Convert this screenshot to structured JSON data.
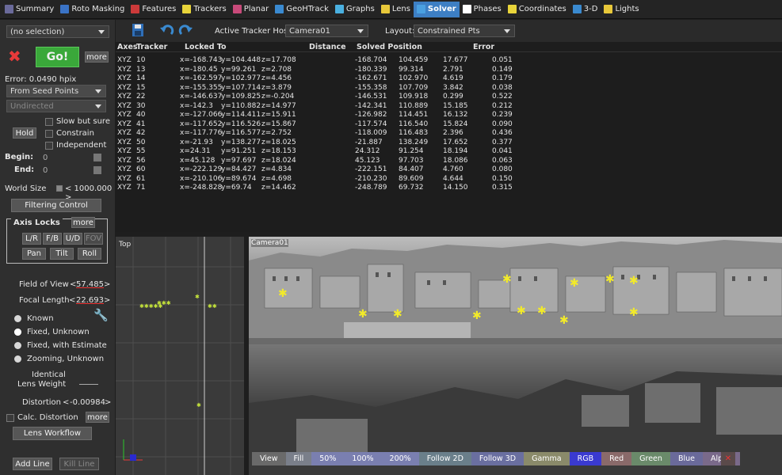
{
  "tabs": [
    {
      "label": "Summary",
      "icon": "summary-icon",
      "color": "#6a6a9a"
    },
    {
      "label": "Roto Masking",
      "icon": "roto-masking-icon",
      "color": "#3a73c6"
    },
    {
      "label": "Features",
      "icon": "features-icon",
      "color": "#cc3a3a"
    },
    {
      "label": "Trackers",
      "icon": "trackers-icon",
      "color": "#e8d43a"
    },
    {
      "label": "Planar",
      "icon": "planar-icon",
      "color": "#c84a7a"
    },
    {
      "label": "GeoHTrack",
      "icon": "geohtrack-icon",
      "color": "#3a8ad0"
    },
    {
      "label": "Graphs",
      "icon": "graphs-icon",
      "color": "#4ab0e0"
    },
    {
      "label": "Lens",
      "icon": "lens-icon",
      "color": "#e8c83a"
    },
    {
      "label": "Solver",
      "icon": "solver-icon",
      "color": "#4aa0e0",
      "active": true
    },
    {
      "label": "Phases",
      "icon": "phases-icon",
      "color": "#ffffff"
    },
    {
      "label": "Coordinates",
      "icon": "coordinates-icon",
      "color": "#e8d43a"
    },
    {
      "label": "3-D",
      "icon": "3d-icon",
      "color": "#3a8ad0"
    },
    {
      "label": "Lights",
      "icon": "lights-icon",
      "color": "#e8c83a"
    }
  ],
  "left": {
    "selection": "(no selection)",
    "go": "Go!",
    "more": "more",
    "error": "Error:  0.0490 hpix",
    "from_seed": "From Seed Points",
    "undirected": "Undirected",
    "slow": "Slow but sure",
    "hold": "Hold",
    "constrain": "Constrain",
    "independent": "Independent",
    "begin_label": "Begin:",
    "begin_val": "0",
    "end_label": "End:",
    "end_val": "0",
    "world_size_label": "World Size",
    "world_size_val": "< 1000.000 >",
    "filtering": "Filtering Control",
    "axis_locks": "Axis Locks",
    "axis_more": "more",
    "lr": "L/R",
    "fb": "F/B",
    "ud": "U/D",
    "fov": "FOV",
    "pan": "Pan",
    "tilt": "Tilt",
    "roll": "Roll",
    "fov_label": "Field of View",
    "fov_val": "57.485",
    "focal_label": "Focal Length",
    "focal_val": "22.693",
    "known": "Known",
    "fixed_unknown": "Fixed, Unknown",
    "fixed_estimate": "Fixed, with Estimate",
    "zooming": "Zooming, Unknown",
    "identical": "Identical",
    "lens_weight": "Lens Weight",
    "distortion_label": "Distortion",
    "distortion_val": "-0.00984",
    "calc_distortion": "Calc. Distortion",
    "calc_more": "more",
    "lens_workflow": "Lens Workflow",
    "add_line": "Add Line",
    "kill_line": "Kill Line",
    "lt": "<",
    "gt": ">"
  },
  "toolbar": {
    "host_label": "Active Tracker Host:",
    "host_value": "Camera01",
    "layout_label": "Layout:",
    "layout_value": "Constrained Pts"
  },
  "table": {
    "headers": {
      "axes": "Axes",
      "tracker": "Tracker",
      "locked": "Locked To",
      "distance": "Distance",
      "solved": "Solved Position",
      "error": "Error"
    },
    "rows": [
      {
        "axes": "XYZ",
        "tracker": "10",
        "lx": "x=-168.743",
        "ly": "y=104.448",
        "lz": "z=17.708",
        "sx": "-168.704",
        "sy": "104.459",
        "sz": "17.677",
        "err": "0.051"
      },
      {
        "axes": "XYZ",
        "tracker": "13",
        "lx": "x=-180.45",
        "ly": "y=99.261",
        "lz": "z=2.708",
        "sx": "-180.339",
        "sy": "99.314",
        "sz": "2.791",
        "err": "0.149"
      },
      {
        "axes": "XYZ",
        "tracker": "14",
        "lx": "x=-162.597",
        "ly": "y=102.977",
        "lz": "z=4.456",
        "sx": "-162.671",
        "sy": "102.970",
        "sz": "4.619",
        "err": "0.179"
      },
      {
        "axes": "XYZ",
        "tracker": "15",
        "lx": "x=-155.355",
        "ly": "y=107.714",
        "lz": "z=3.879",
        "sx": "-155.358",
        "sy": "107.709",
        "sz": "3.842",
        "err": "0.038"
      },
      {
        "axes": "XYZ",
        "tracker": "22",
        "lx": "x=-146.637",
        "ly": "y=109.825",
        "lz": "z=-0.204",
        "sx": "-146.531",
        "sy": "109.918",
        "sz": "0.299",
        "err": "0.522"
      },
      {
        "axes": "XYZ",
        "tracker": "30",
        "lx": "x=-142.3",
        "ly": "y=110.882",
        "lz": "z=14.977",
        "sx": "-142.341",
        "sy": "110.889",
        "sz": "15.185",
        "err": "0.212"
      },
      {
        "axes": "XYZ",
        "tracker": "40",
        "lx": "x=-127.066",
        "ly": "y=114.411",
        "lz": "z=15.911",
        "sx": "-126.982",
        "sy": "114.451",
        "sz": "16.132",
        "err": "0.239"
      },
      {
        "axes": "XYZ",
        "tracker": "41",
        "lx": "x=-117.652",
        "ly": "y=116.526",
        "lz": "z=15.867",
        "sx": "-117.574",
        "sy": "116.540",
        "sz": "15.824",
        "err": "0.090"
      },
      {
        "axes": "XYZ",
        "tracker": "42",
        "lx": "x=-117.776",
        "ly": "y=116.577",
        "lz": "z=2.752",
        "sx": "-118.009",
        "sy": "116.483",
        "sz": "2.396",
        "err": "0.436"
      },
      {
        "axes": "XYZ",
        "tracker": "50",
        "lx": "x=-21.93",
        "ly": "y=138.277",
        "lz": "z=18.025",
        "sx": "-21.887",
        "sy": "138.249",
        "sz": "17.652",
        "err": "0.377"
      },
      {
        "axes": "XYZ",
        "tracker": "55",
        "lx": "x=24.31",
        "ly": "y=91.251",
        "lz": "z=18.153",
        "sx": "24.312",
        "sy": "91.254",
        "sz": "18.194",
        "err": "0.041"
      },
      {
        "axes": "XYZ",
        "tracker": "56",
        "lx": "x=45.128",
        "ly": "y=97.697",
        "lz": "z=18.024",
        "sx": "45.123",
        "sy": "97.703",
        "sz": "18.086",
        "err": "0.063"
      },
      {
        "axes": "XYZ",
        "tracker": "60",
        "lx": "x=-222.129",
        "ly": "y=84.427",
        "lz": "z=4.834",
        "sx": "-222.151",
        "sy": "84.407",
        "sz": "4.760",
        "err": "0.080"
      },
      {
        "axes": "XYZ",
        "tracker": "61",
        "lx": "x=-210.106",
        "ly": "y=89.674",
        "lz": "z=4.698",
        "sx": "-210.230",
        "sy": "89.609",
        "sz": "4.644",
        "err": "0.150"
      },
      {
        "axes": "XYZ",
        "tracker": "71",
        "lx": "x=-248.828",
        "ly": "y=69.74",
        "lz": "z=14.462",
        "sx": "-248.789",
        "sy": "69.732",
        "sz": "14.150",
        "err": "0.315"
      }
    ]
  },
  "topview": {
    "label": "Top"
  },
  "camview": {
    "label": "Camera01"
  },
  "viewbar": [
    {
      "label": "View",
      "bg": "#6a6a6a"
    },
    {
      "label": "Fill",
      "bg": "#7a7f8a"
    },
    {
      "label": "50%",
      "bg": "#7a7fb0"
    },
    {
      "label": "100%",
      "bg": "#7a7fb0"
    },
    {
      "label": "200%",
      "bg": "#7a7fb0"
    },
    {
      "label": "Follow 2D",
      "bg": "#6a7f8a"
    },
    {
      "label": "Follow 3D",
      "bg": "#6a6fa0"
    },
    {
      "label": "Gamma",
      "bg": "#8a8a6a"
    },
    {
      "label": "RGB",
      "bg": "#3a3ad0"
    },
    {
      "label": "Red",
      "bg": "#8a6a6a"
    },
    {
      "label": "Green",
      "bg": "#6a8a6a"
    },
    {
      "label": "Blue",
      "bg": "#6a6a9a"
    },
    {
      "label": "Alpha",
      "bg": "#7a6a8a"
    }
  ]
}
